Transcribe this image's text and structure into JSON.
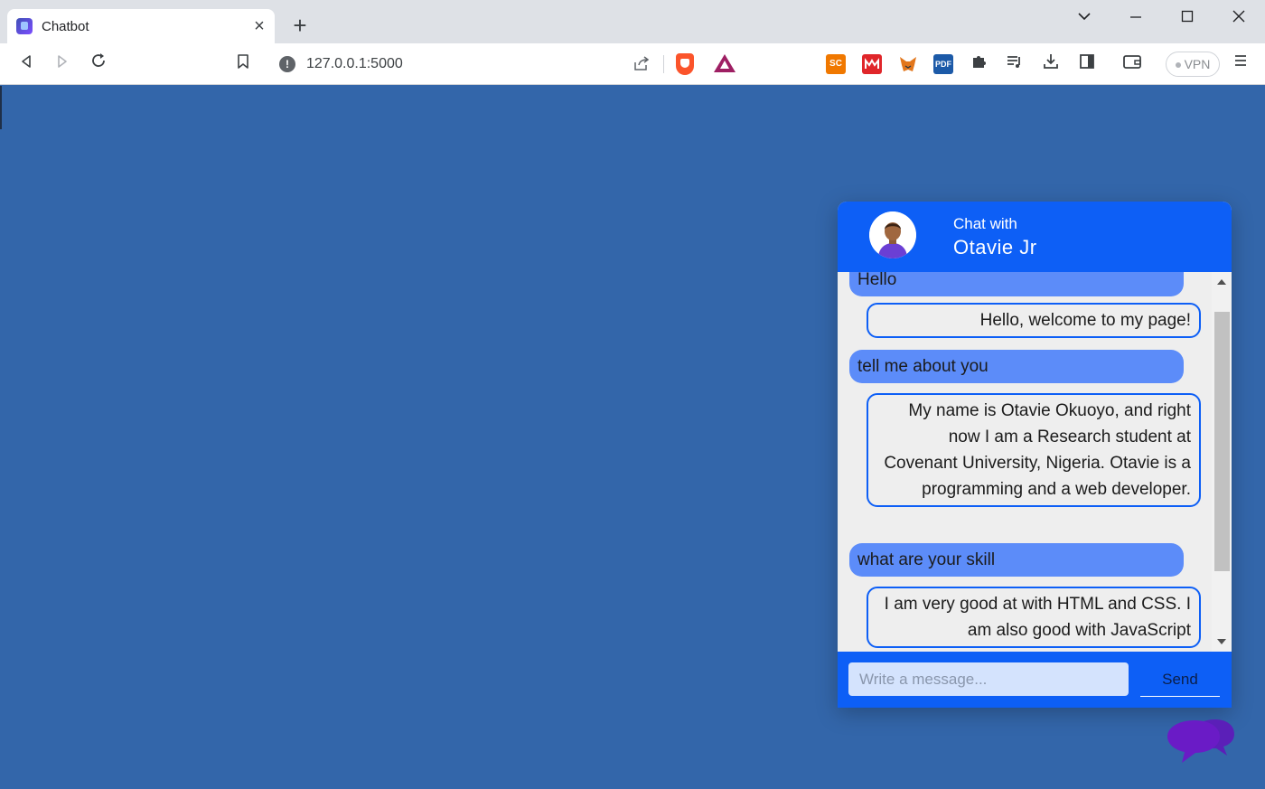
{
  "browser": {
    "tab_title": "Chatbot",
    "tab_close": "×",
    "new_tab": "+",
    "url": "127.0.0.1:5000",
    "url_info": "!",
    "extensions": {
      "sc_label": "SC",
      "pdf_label": "PDF"
    },
    "vpn_label": "VPN",
    "colors": {
      "tabbar": "#dee1e6",
      "toolbar": "#ffffff"
    }
  },
  "page": {
    "background": "#3366aa"
  },
  "chat": {
    "header": {
      "subtitle": "Chat with",
      "name": "Otavie Jr"
    },
    "messages": [
      {
        "from": "user",
        "text": "Hello"
      },
      {
        "from": "bot",
        "text": "Hello, welcome to my page!"
      },
      {
        "from": "user",
        "text": "tell me about you"
      },
      {
        "from": "bot",
        "text": "My name is Otavie Okuoyo, and right now I am a Research student at Covenant University, Nigeria. Otavie is a programming and a web developer."
      },
      {
        "from": "user",
        "text": "what are your skill"
      },
      {
        "from": "bot",
        "text": "I am very good at with HTML and CSS. I am also good with JavaScript"
      }
    ],
    "input": {
      "placeholder": "Write a message...",
      "value": ""
    },
    "send_label": "Send",
    "colors": {
      "primary": "#0d5ff6",
      "user_bubble": "#5c8cf9",
      "input_bg": "#d4e3fd",
      "launcher": "#6a1bc6"
    }
  }
}
